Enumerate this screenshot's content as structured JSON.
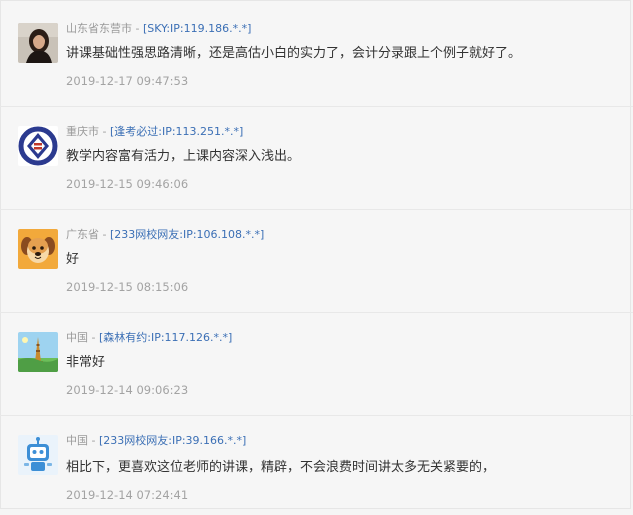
{
  "comments": [
    {
      "location": "山东省东营市",
      "separator": " - ",
      "user": "[SKY:IP:119.186.*.*]",
      "text": "讲课基础性强思路清晰，还是高估小白的实力了，会计分录跟上个例子就好了。",
      "time": "2019-12-17 09:47:53",
      "avatar_icon": "portrait-photo-icon"
    },
    {
      "location": "重庆市",
      "separator": " - ",
      "user": "[逢考必过:IP:113.251.*.*]",
      "text": "教学内容富有活力，上课内容深入浅出。",
      "time": "2019-12-15 09:46:06",
      "avatar_icon": "blue-logo-icon"
    },
    {
      "location": "广东省",
      "separator": " - ",
      "user": "[233网校网友:IP:106.108.*.*]",
      "text": "好",
      "time": "2019-12-15 08:15:06",
      "avatar_icon": "dog-icon"
    },
    {
      "location": "中国",
      "separator": " - ",
      "user": "[森林有约:IP:117.126.*.*]",
      "text": "非常好",
      "time": "2019-12-14 09:06:23",
      "avatar_icon": "tower-landscape-icon"
    },
    {
      "location": "中国",
      "separator": " - ",
      "user": "[233网校网友:IP:39.166.*.*]",
      "text": "相比下，更喜欢这位老师的讲课，精辟，不会浪费时间讲太多无关紧要的，",
      "time": "2019-12-14 07:24:41",
      "avatar_icon": "robot-icon"
    }
  ],
  "colors": {
    "link": "#3b6fb5",
    "location": "#9a9a9a",
    "time": "#a3a3a3",
    "text": "#333333"
  }
}
